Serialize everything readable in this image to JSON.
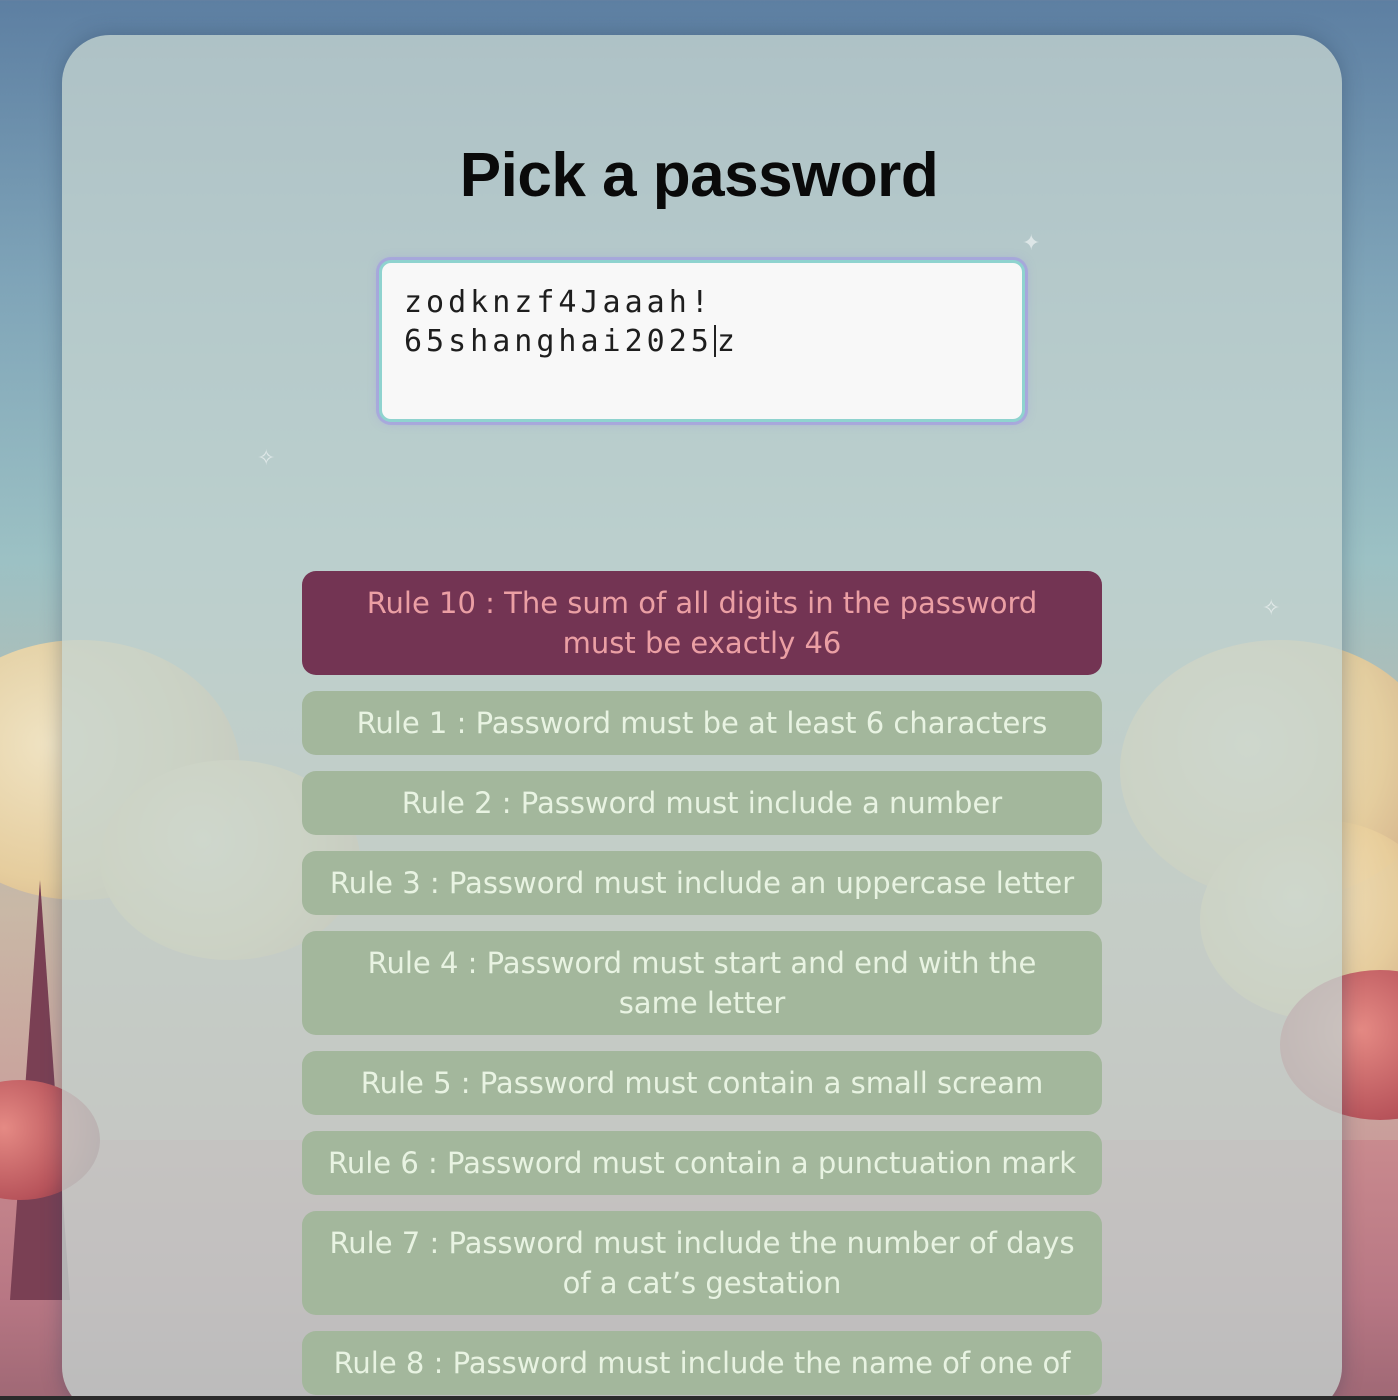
{
  "page": {
    "title": "Pick a password"
  },
  "password": {
    "line1": "zodknzf4Jaaah!",
    "line2_before_caret": "65shanghai2025",
    "line2_after_caret": "z"
  },
  "rules": [
    {
      "label": "Rule 10 : The sum of all digits in the password must be exactly 46",
      "status": "failed"
    },
    {
      "label": "Rule 1 : Password must be at least 6 characters",
      "status": "passed"
    },
    {
      "label": "Rule 2 : Password must include a number",
      "status": "passed"
    },
    {
      "label": "Rule 3 : Password must include an uppercase letter",
      "status": "passed"
    },
    {
      "label": "Rule 4 : Password must start and end with the same letter",
      "status": "passed"
    },
    {
      "label": "Rule 5 : Password must contain a small scream",
      "status": "passed"
    },
    {
      "label": "Rule 6 : Password must contain a punctuation mark",
      "status": "passed"
    },
    {
      "label": "Rule 7 : Password must include the number of days of a cat’s gestation",
      "status": "passed"
    },
    {
      "label": "Rule 8 : Password must include the name of one of",
      "status": "passed"
    }
  ],
  "colors": {
    "failed_bg": "#733453",
    "failed_text": "#eb9fa4",
    "passed_bg": "#a3b79c",
    "passed_text": "#e8f3e2",
    "input_border": "#8fd3cf"
  }
}
